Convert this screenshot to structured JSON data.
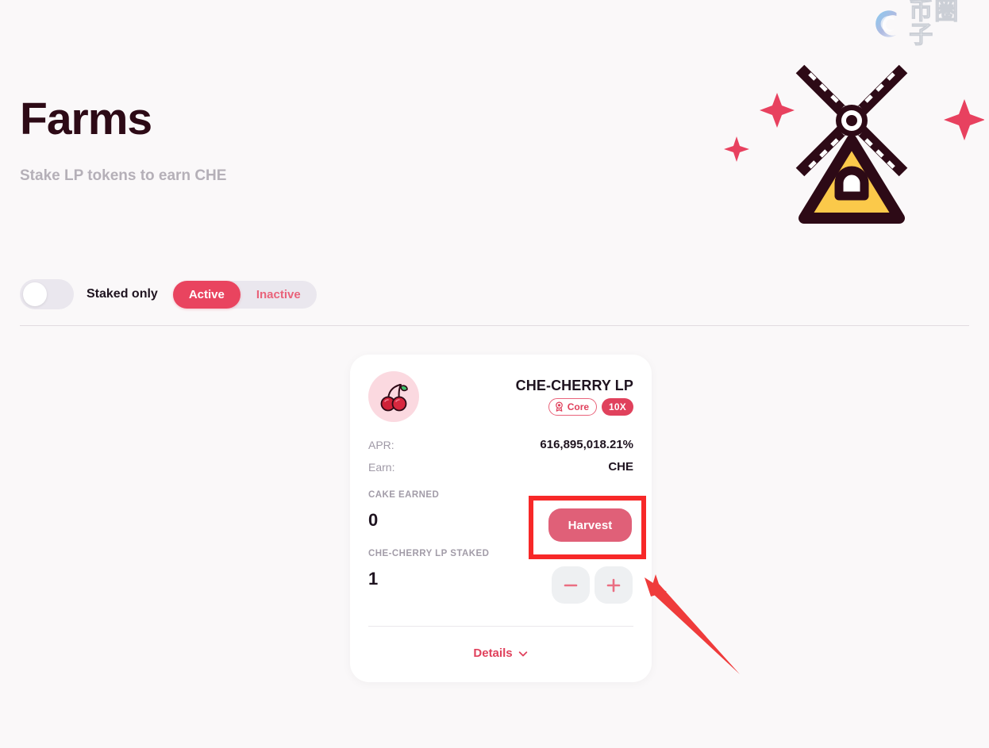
{
  "watermark": {
    "logo_icon": "swirl-c-logo-icon",
    "text": "币圈子"
  },
  "header": {
    "title": "Farms",
    "subtitle": "Stake LP tokens to earn CHE",
    "illustration_icon": "windmill-illustration"
  },
  "filters": {
    "staked_only_label": "Staked only",
    "staked_only_enabled": false,
    "status_options": [
      {
        "label": "Active",
        "selected": true
      },
      {
        "label": "Inactive",
        "selected": false
      }
    ]
  },
  "farm_card": {
    "token_icon": "cherry-icon",
    "name": "CHE-CHERRY LP",
    "badges": [
      {
        "label": "Core",
        "icon": "medal-icon",
        "style": "outline"
      },
      {
        "label": "10X",
        "style": "filled"
      }
    ],
    "apr_label": "APR:",
    "apr_value": "616,895,018.21%",
    "earn_label": "Earn:",
    "earn_value": "CHE",
    "earned_label": "CAKE EARNED",
    "earned_value": "0",
    "harvest_label": "Harvest",
    "staked_label": "CHE-CHERRY LP STAKED",
    "staked_value": "1",
    "decrease_icon": "minus-icon",
    "increase_icon": "plus-icon",
    "details_label": "Details",
    "details_chevron_icon": "chevron-down-icon"
  },
  "annotations": {
    "highlight_box_target": "harvest-button",
    "arrow_target": "increase-stake-button",
    "color": "#f72828"
  },
  "colors": {
    "accent": "#e0415c",
    "accent_active": "#e9445f",
    "title": "#2d0a16",
    "background": "#faf8f9",
    "card": "#ffffff",
    "annotation": "#f72828"
  }
}
